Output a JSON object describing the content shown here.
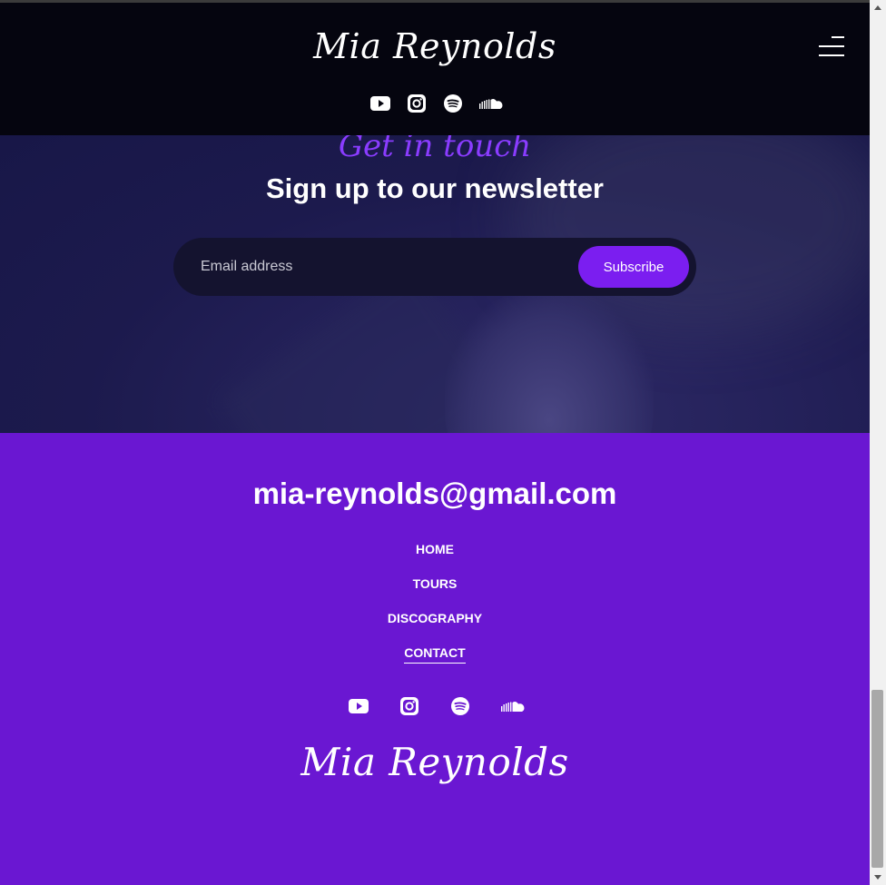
{
  "header": {
    "brand": "Mia Reynolds",
    "menu_icon": "hamburger-menu-icon",
    "social": [
      {
        "name": "youtube",
        "icon": "youtube-icon"
      },
      {
        "name": "instagram",
        "icon": "instagram-icon"
      },
      {
        "name": "spotify",
        "icon": "spotify-icon"
      },
      {
        "name": "soundcloud",
        "icon": "soundcloud-icon"
      }
    ]
  },
  "newsletter": {
    "eyebrow": "Get in touch",
    "heading": "Sign up to our newsletter",
    "email_placeholder": "Email address",
    "subscribe_label": "Subscribe"
  },
  "footer": {
    "email": "mia-reynolds@gmail.com",
    "nav": [
      {
        "label": "HOME",
        "active": false
      },
      {
        "label": "TOURS",
        "active": false
      },
      {
        "label": "DISCOGRAPHY",
        "active": false
      },
      {
        "label": "CONTACT",
        "active": true
      }
    ],
    "brand": "Mia Reynolds"
  },
  "colors": {
    "accent": "#7b1ef0",
    "footer_bg": "#6a17d2",
    "header_bg": "#05050f",
    "eyebrow": "#8a3cff"
  }
}
